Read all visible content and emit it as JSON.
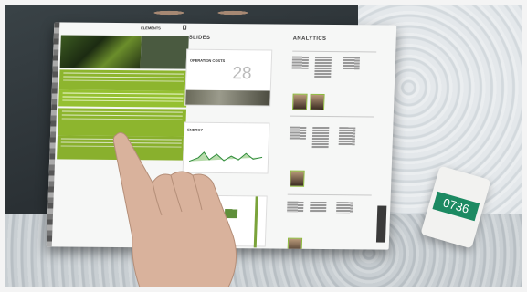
{
  "tablet": {
    "menu_title": "ELEMENTS",
    "sections": {
      "slides": "SLIDES",
      "analytics": "ANALYTICS"
    },
    "slide_cards": [
      {
        "label": "OPERATION COSTS",
        "value": "28"
      },
      {
        "label": "ENERGY",
        "value": ""
      }
    ],
    "analytics_labels": [
      "ELECTRIC",
      "SAVINGS",
      "EXPORTED",
      "SOURCES",
      "STATIONS",
      "AUDIT"
    ]
  },
  "phone": {
    "screen_text": "0736"
  },
  "colors": {
    "accent_lime": "#8db52e",
    "phone_green": "#1c8a62"
  }
}
